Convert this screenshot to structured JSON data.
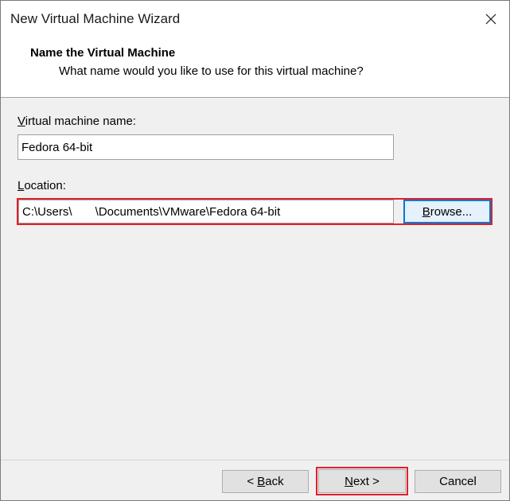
{
  "window": {
    "title": "New Virtual Machine Wizard"
  },
  "header": {
    "title": "Name the Virtual Machine",
    "subtitle": "What name would you like to use for this virtual machine?"
  },
  "vm_name": {
    "label_mnemonic": "V",
    "label_rest": "irtual machine name:",
    "value": "Fedora 64-bit"
  },
  "location": {
    "label_mnemonic": "L",
    "label_rest": "ocation:",
    "value": "C:\\Users\\       \\Documents\\VMware\\Fedora 64-bit",
    "browse_mnemonic": "B",
    "browse_rest": "rowse..."
  },
  "footer": {
    "back_prefix": "< ",
    "back_mnemonic": "B",
    "back_rest": "ack",
    "next_mnemonic": "N",
    "next_rest": "ext >",
    "cancel_label": "Cancel"
  },
  "colors": {
    "highlight": "#e0202a",
    "focus": "#0078d7"
  }
}
